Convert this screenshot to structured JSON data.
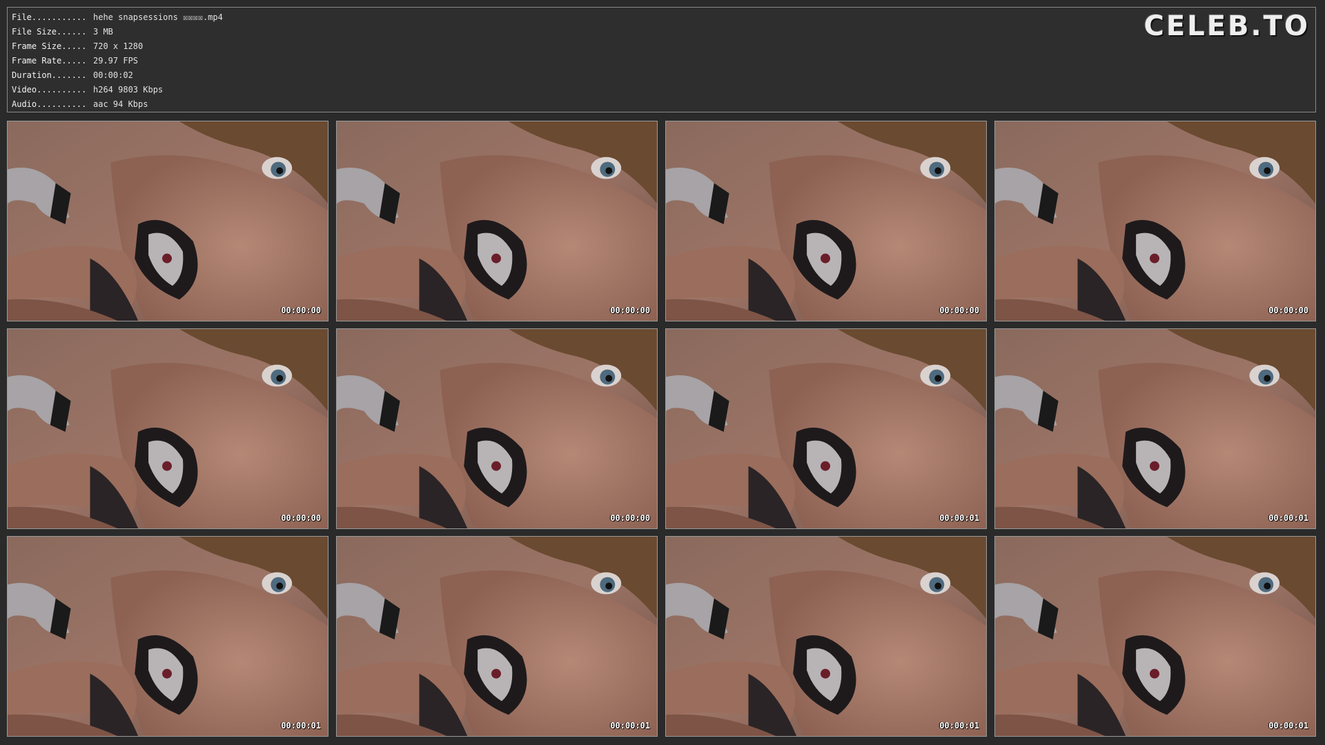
{
  "header": {
    "info": [
      {
        "key": "File...........",
        "value": "hehe snapsessions ☒☒☒☒.mp4"
      },
      {
        "key": "File Size......",
        "value": "3 MB"
      },
      {
        "key": "Frame Size.....",
        "value": "720 x 1280"
      },
      {
        "key": "Frame Rate.....",
        "value": "29.97 FPS"
      },
      {
        "key": "Duration.......",
        "value": "00:00:02"
      },
      {
        "key": "Video..........",
        "value": "h264 9803 Kbps"
      },
      {
        "key": "Audio..........",
        "value": "aac 94 Kbps"
      }
    ],
    "logo": "CELEB.TO"
  },
  "thumbnails": [
    {
      "timestamp": "00:00:00"
    },
    {
      "timestamp": "00:00:00"
    },
    {
      "timestamp": "00:00:00"
    },
    {
      "timestamp": "00:00:00"
    },
    {
      "timestamp": "00:00:00"
    },
    {
      "timestamp": "00:00:00"
    },
    {
      "timestamp": "00:00:01"
    },
    {
      "timestamp": "00:00:01"
    },
    {
      "timestamp": "00:00:01"
    },
    {
      "timestamp": "00:00:01"
    },
    {
      "timestamp": "00:00:01"
    },
    {
      "timestamp": "00:00:01"
    }
  ],
  "colors": {
    "background": "#2a2a2a",
    "border": "#9a9a9a",
    "text": "#e8e8e8"
  }
}
